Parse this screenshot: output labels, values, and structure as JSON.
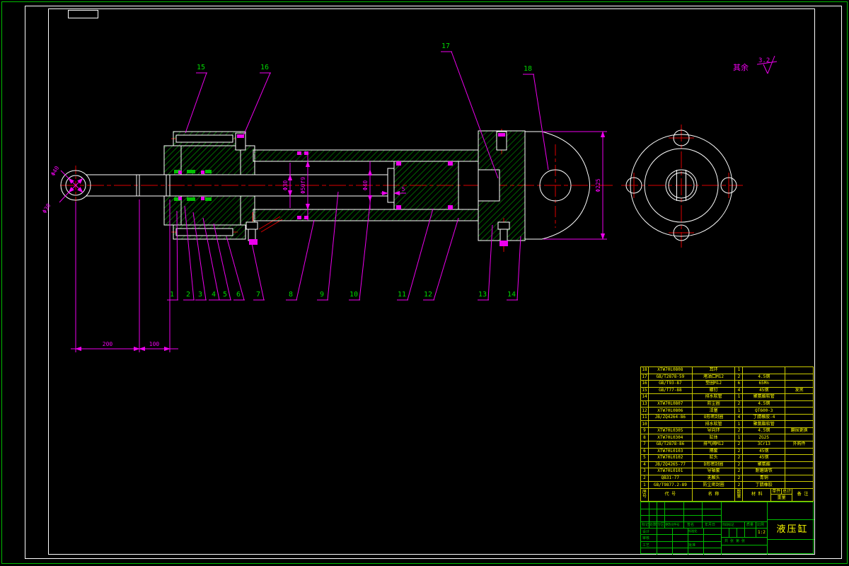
{
  "colors": {
    "background": "#000000",
    "outline": "#ffffff",
    "hatch": "#00c000",
    "centerline": "#dd0000",
    "dimension": "#ee00ee",
    "part_label": "#00d800",
    "table": "#ffff00",
    "title_block": "#00bb00"
  },
  "surface_note": {
    "prefix": "其余",
    "roughness": "3.2"
  },
  "part_labels": [
    "1",
    "2",
    "3",
    "4",
    "5",
    "6",
    "7",
    "8",
    "9",
    "10",
    "11",
    "12",
    "13",
    "14",
    "15",
    "16",
    "17",
    "18"
  ],
  "dims": {
    "eye_outer": "Φ40",
    "eye_inner": "Φ30",
    "rod": "Φ30",
    "bore": "Φ50f9",
    "piston": "Φ40",
    "collar_gap": "5",
    "clevis": "Φ225",
    "length_total": "200",
    "length_mid": "100"
  },
  "bom": {
    "headers": {
      "no": "序号",
      "code": "代 号",
      "name": "名 称",
      "qty": "数量",
      "material": "材 料",
      "weight_each": "单件",
      "weight_total": "总计",
      "weight_label": "重量",
      "note": "备 注"
    },
    "rows": [
      {
        "no": "18",
        "code": "XTW70L0808",
        "name": "耳环",
        "qty": "1",
        "material": "",
        "note": ""
      },
      {
        "no": "17",
        "code": "GB/T2878-59",
        "name": "堵油口M12",
        "qty": "2",
        "material": "4.5钢",
        "note": ""
      },
      {
        "no": "16",
        "code": "GB/T93-87",
        "name": "垫圈M12",
        "qty": "6",
        "material": "65Mn",
        "note": ""
      },
      {
        "no": "15",
        "code": "GB/T77-88",
        "name": "螺钉",
        "qty": "4",
        "material": "45钢",
        "note": "发黑"
      },
      {
        "no": "14",
        "code": "",
        "name": "排水软管",
        "qty": "1",
        "material": "聚氨酯软管",
        "note": ""
      },
      {
        "no": "13",
        "code": "XTW70L0807",
        "name": "防尘圈",
        "qty": "2",
        "material": "4.5钢",
        "note": ""
      },
      {
        "no": "12",
        "code": "XTW70L0806",
        "name": "活塞",
        "qty": "1",
        "material": "QT600-3",
        "note": ""
      },
      {
        "no": "11",
        "code": "JB/ZQ4264-86",
        "name": "O形密封圈",
        "qty": "4",
        "material": "丁腈橡胶-4",
        "note": ""
      },
      {
        "no": "10",
        "code": "",
        "name": "排水软管",
        "qty": "1",
        "material": "聚氨酯软管",
        "note": ""
      },
      {
        "no": "9",
        "code": "XTW70L0305",
        "name": "导向环",
        "qty": "2",
        "material": "4.5钢",
        "note": "磨损更换"
      },
      {
        "no": "8",
        "code": "XTW70L0304",
        "name": "缸体",
        "qty": "1",
        "material": "ZG25",
        "note": ""
      },
      {
        "no": "7",
        "code": "GB/T2878-86",
        "name": "排气阀M12",
        "qty": "2",
        "material": "3Cr13",
        "note": "外购件"
      },
      {
        "no": "6",
        "code": "XTW70L0103",
        "name": "隔套",
        "qty": "2",
        "material": "45钢",
        "note": ""
      },
      {
        "no": "5",
        "code": "XTW70L0102",
        "name": "缸头",
        "qty": "2",
        "material": "45钢",
        "note": ""
      },
      {
        "no": "4",
        "code": "JB/ZQ4265-77",
        "name": "D形密封圈",
        "qty": "2",
        "material": "聚氨酯",
        "note": ""
      },
      {
        "no": "3",
        "code": "XTW70L0101",
        "name": "导轴套",
        "qty": "2",
        "material": "耐磨铸铁",
        "note": ""
      },
      {
        "no": "2",
        "code": "QB31-77",
        "name": "无触头",
        "qty": "2",
        "material": "青铜",
        "note": ""
      },
      {
        "no": "1",
        "code": "GB/T9877.2-89",
        "name": "防尘密封圈",
        "qty": "2",
        "material": "丁腈橡胶",
        "note": ""
      }
    ]
  },
  "title_block": {
    "revision_cols": [
      "标记",
      "处数",
      "分区",
      "更改文件号",
      "签名",
      "年月日"
    ],
    "rows": [
      "设计",
      "审核",
      "工艺"
    ],
    "standardization": "标准化",
    "approve": "批准",
    "stage_label": "阶段标记",
    "mass_label": "质量",
    "scale_label": "比例",
    "scale_value": "1:2",
    "sheet_note": "共 张 第 张",
    "drawing_title": "液压缸"
  }
}
